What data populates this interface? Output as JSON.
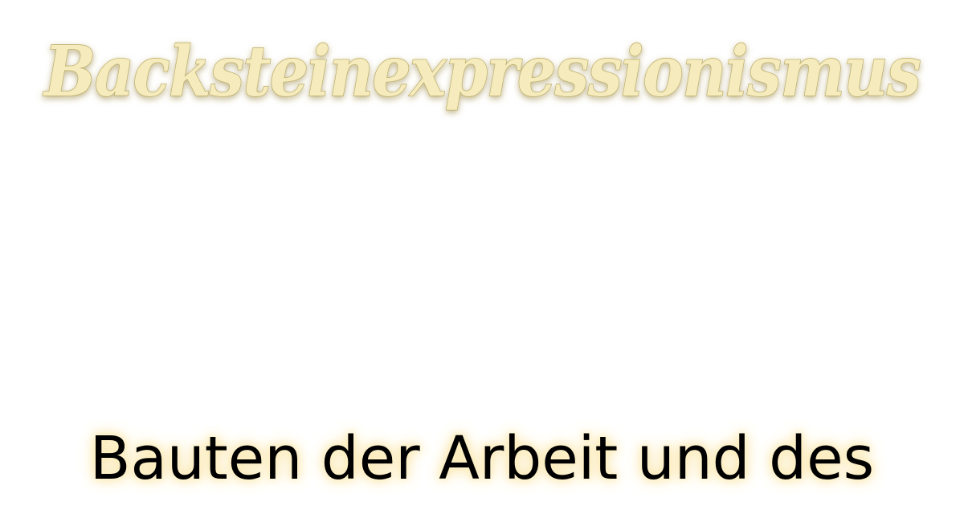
{
  "logo": {
    "text": "Backsteinexpressionismus",
    "fill_color": "#f5ebbd",
    "glow_color": "#8f7a2c"
  },
  "subtitle": {
    "text": "Bauten der Arbeit und des"
  }
}
